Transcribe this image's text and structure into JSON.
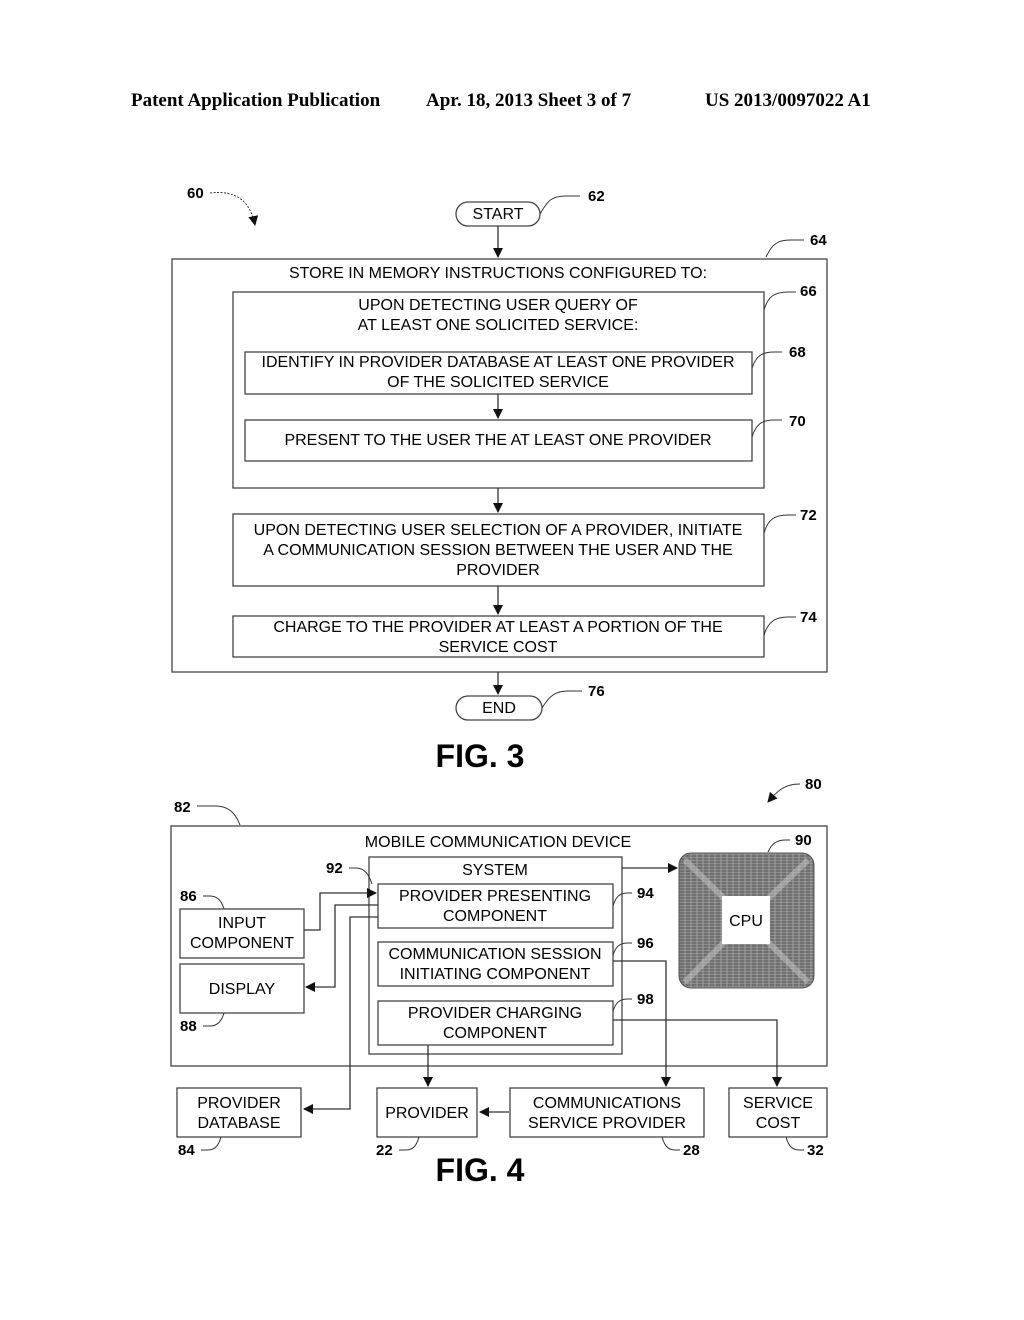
{
  "header": {
    "publication": "Patent Application Publication",
    "date_sheet": "Apr. 18, 2013  Sheet 3 of 7",
    "number": "US 2013/0097022 A1"
  },
  "fig3": {
    "caption": "FIG. 3",
    "refs": {
      "method": "60",
      "start": "62",
      "outer": "64",
      "query": "66",
      "identify": "68",
      "present": "70",
      "initiate": "72",
      "charge": "74",
      "end": "76"
    },
    "start": "START",
    "end": "END",
    "outer_title": "STORE IN MEMORY INSTRUCTIONS CONFIGURED TO:",
    "query_lines": [
      "UPON DETECTING USER QUERY OF",
      "AT LEAST ONE SOLICITED SERVICE:"
    ],
    "identify_lines": [
      "IDENTIFY IN PROVIDER DATABASE AT LEAST ONE PROVIDER",
      "OF THE SOLICITED SERVICE"
    ],
    "present_lines": [
      "PRESENT TO THE USER THE AT LEAST ONE PROVIDER"
    ],
    "initiate_lines": [
      "UPON DETECTING USER SELECTION OF A PROVIDER, INITIATE",
      "A COMMUNICATION SESSION BETWEEN THE USER AND THE",
      "PROVIDER"
    ],
    "charge_lines": [
      "CHARGE TO THE PROVIDER AT LEAST A PORTION OF THE",
      "SERVICE COST"
    ]
  },
  "fig4": {
    "caption": "FIG. 4",
    "refs": {
      "system_diagram": "80",
      "device": "82",
      "provider_db": "84",
      "input": "86",
      "display": "88",
      "cpu": "90",
      "system": "92",
      "presenting": "94",
      "session": "96",
      "charging": "98",
      "provider": "22",
      "csp": "28",
      "service_cost": "32"
    },
    "device_title": "MOBILE COMMUNICATION DEVICE",
    "system_title": "SYSTEM",
    "presenting_lines": [
      "PROVIDER PRESENTING",
      "COMPONENT"
    ],
    "session_lines": [
      "COMMUNICATION SESSION",
      "INITIATING COMPONENT"
    ],
    "charging_lines": [
      "PROVIDER CHARGING",
      "COMPONENT"
    ],
    "input_lines": [
      "INPUT",
      "COMPONENT"
    ],
    "display": "DISPLAY",
    "cpu": "CPU",
    "provider_db_lines": [
      "PROVIDER",
      "DATABASE"
    ],
    "provider": "PROVIDER",
    "csp_lines": [
      "COMMUNICATIONS",
      "SERVICE PROVIDER"
    ],
    "service_cost_lines": [
      "SERVICE",
      "COST"
    ]
  }
}
